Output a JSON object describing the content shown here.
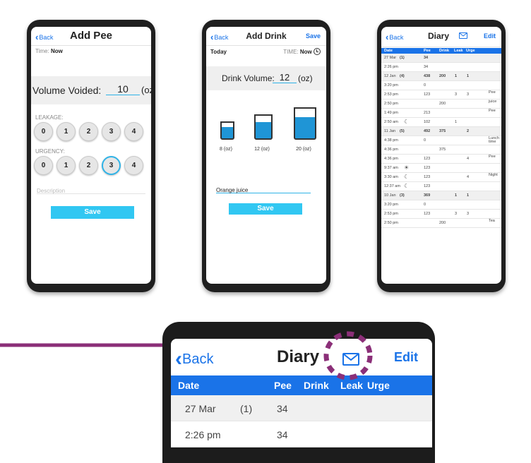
{
  "add_pee": {
    "back": "Back",
    "title": "Add Pee",
    "time_label": "Time:",
    "time_value": "Now",
    "volume_label": "Volume Voided:",
    "volume_value": "10",
    "volume_unit": "(oz)",
    "leakage_label": "LEAKAGE:",
    "urgency_label": "URGENCY:",
    "options": [
      "0",
      "1",
      "2",
      "3",
      "4"
    ],
    "urgency_selected": "3",
    "description_placeholder": "Description",
    "save": "Save"
  },
  "add_drink": {
    "back": "Back",
    "title": "Add Drink",
    "save_top": "Save",
    "today": "Today",
    "time_label": "TIME:",
    "time_value": "Now",
    "volume_label": "Drink Volume:",
    "volume_value": "12",
    "volume_unit": "(oz)",
    "cups": [
      {
        "label": "8 (oz)"
      },
      {
        "label": "12 (oz)"
      },
      {
        "label": "20 (oz)"
      }
    ],
    "description_value": "Orange juice",
    "save": "Save"
  },
  "diary": {
    "back": "Back",
    "title": "Diary",
    "edit": "Edit",
    "columns": [
      "Date",
      "Pee",
      "Drink",
      "Leak",
      "Urge"
    ],
    "rows": [
      {
        "date": "27 Mar",
        "count": "(1)",
        "pee": "34",
        "drink": "",
        "leak": "",
        "urge": "",
        "note": "",
        "grey": true,
        "icon": ""
      },
      {
        "date": "2:26 pm",
        "count": "",
        "pee": "34",
        "drink": "",
        "leak": "",
        "urge": "",
        "note": "",
        "grey": false,
        "icon": ""
      },
      {
        "date": "12 Jan",
        "count": "(4)",
        "pee": "438",
        "drink": "200",
        "leak": "1",
        "urge": "1",
        "note": "",
        "grey": true,
        "icon": ""
      },
      {
        "date": "3:20 pm",
        "count": "",
        "pee": "0",
        "drink": "",
        "leak": "",
        "urge": "",
        "note": "",
        "grey": false,
        "icon": ""
      },
      {
        "date": "2:53 pm",
        "count": "",
        "pee": "123",
        "drink": "",
        "leak": "3",
        "urge": "3",
        "note": "Pee",
        "grey": false,
        "icon": ""
      },
      {
        "date": "2:50 pm",
        "count": "",
        "pee": "",
        "drink": "200",
        "leak": "",
        "urge": "",
        "note": "juice",
        "grey": false,
        "icon": ""
      },
      {
        "date": "1:49 pm",
        "count": "",
        "pee": "213",
        "drink": "",
        "leak": "",
        "urge": "",
        "note": "Pee",
        "grey": false,
        "icon": ""
      },
      {
        "date": "2:50 am",
        "count": "",
        "pee": "102",
        "drink": "",
        "leak": "1",
        "urge": "",
        "note": "",
        "grey": false,
        "icon": "moon"
      },
      {
        "date": "11 Jan",
        "count": "(5)",
        "pee": "492",
        "drink": "375",
        "leak": "",
        "urge": "2",
        "note": "",
        "grey": true,
        "icon": ""
      },
      {
        "date": "4:38 pm",
        "count": "",
        "pee": "0",
        "drink": "",
        "leak": "",
        "urge": "",
        "note": "Lunch time",
        "grey": false,
        "icon": ""
      },
      {
        "date": "4:36 pm",
        "count": "",
        "pee": "",
        "drink": "375",
        "leak": "",
        "urge": "",
        "note": "",
        "grey": false,
        "icon": ""
      },
      {
        "date": "4:36 pm",
        "count": "",
        "pee": "123",
        "drink": "",
        "leak": "",
        "urge": "4",
        "note": "Pee",
        "grey": false,
        "icon": ""
      },
      {
        "date": "9:37 am",
        "count": "",
        "pee": "123",
        "drink": "",
        "leak": "",
        "urge": "",
        "note": "",
        "grey": false,
        "icon": "sunrise"
      },
      {
        "date": "3:30 am",
        "count": "",
        "pee": "123",
        "drink": "",
        "leak": "",
        "urge": "4",
        "note": "Night",
        "grey": false,
        "icon": "moon"
      },
      {
        "date": "12:37 am",
        "count": "",
        "pee": "123",
        "drink": "",
        "leak": "",
        "urge": "",
        "note": "",
        "grey": false,
        "icon": "moon"
      },
      {
        "date": "10 Jan",
        "count": "(3)",
        "pee": "369",
        "drink": "",
        "leak": "1",
        "urge": "1",
        "note": "",
        "grey": true,
        "icon": ""
      },
      {
        "date": "3:20 pm",
        "count": "",
        "pee": "0",
        "drink": "",
        "leak": "",
        "urge": "",
        "note": "",
        "grey": false,
        "icon": ""
      },
      {
        "date": "2:53 pm",
        "count": "",
        "pee": "123",
        "drink": "",
        "leak": "3",
        "urge": "3",
        "note": "",
        "grey": false,
        "icon": ""
      },
      {
        "date": "2:50 pm",
        "count": "",
        "pee": "",
        "drink": "200",
        "leak": "",
        "urge": "",
        "note": "Tea",
        "grey": false,
        "icon": ""
      }
    ]
  },
  "zoom": {
    "back": "Back",
    "title": "Diary",
    "edit": "Edit",
    "columns": [
      "Date",
      "Pee",
      "Drink",
      "Leak",
      "Urge"
    ],
    "rows": [
      {
        "date": "27 Mar",
        "count": "(1)",
        "pee": "34"
      },
      {
        "date": "2:26 pm",
        "count": "",
        "pee": "34"
      }
    ]
  },
  "colors": {
    "accent_blue": "#1a73e8",
    "save_button": "#31c7f2",
    "arrow": "#8b2f78",
    "highlight_ring": "#8b2f78"
  }
}
